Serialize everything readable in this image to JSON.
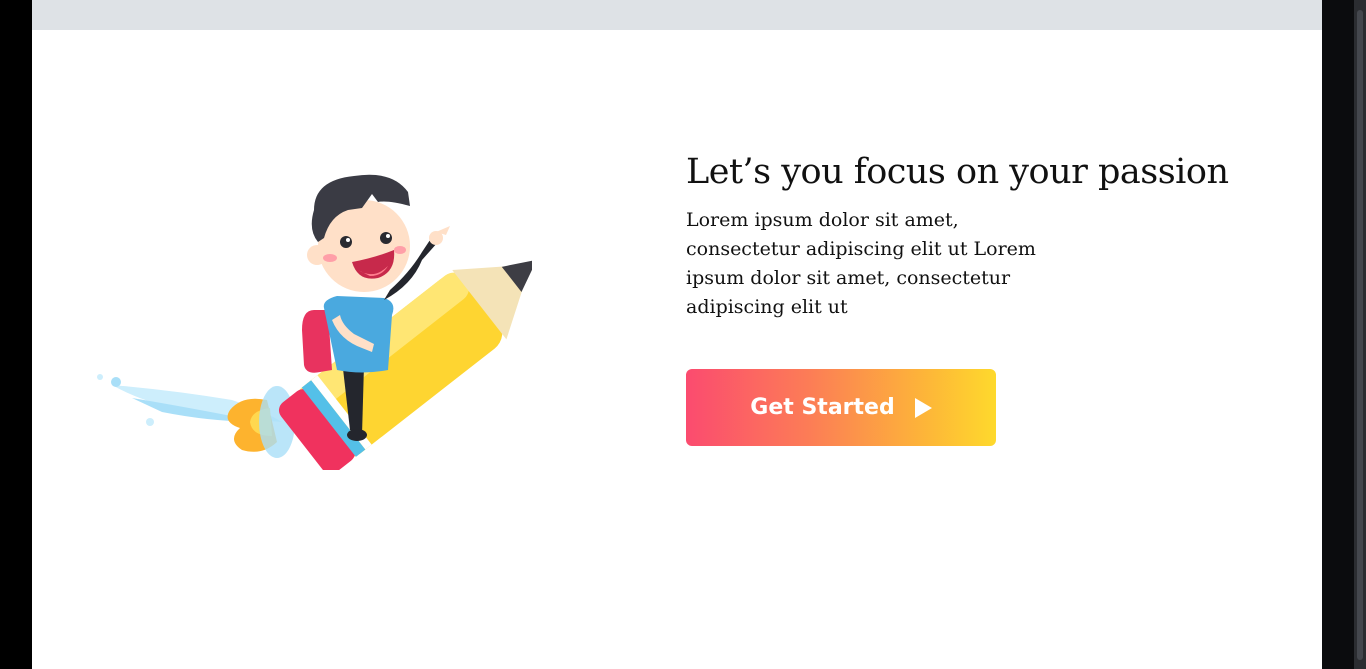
{
  "hero": {
    "title": "Let’s you focus on your passion",
    "body": "Lorem ipsum dolor sit amet, consectetur adipiscing elit ut Lorem ipsum dolor sit amet, consectetur adipiscing elit ut",
    "illustration_icon": "boy-riding-pencil-rocket-illustration"
  },
  "cta": {
    "label": "Get Started",
    "icon": "play-icon",
    "gradient_start": "#fb4b6f",
    "gradient_end": "#fed92c"
  },
  "colors": {
    "page_background": "#ffffff",
    "topbar": "#dee2e6",
    "text": "#111111",
    "frame": "#000000"
  }
}
